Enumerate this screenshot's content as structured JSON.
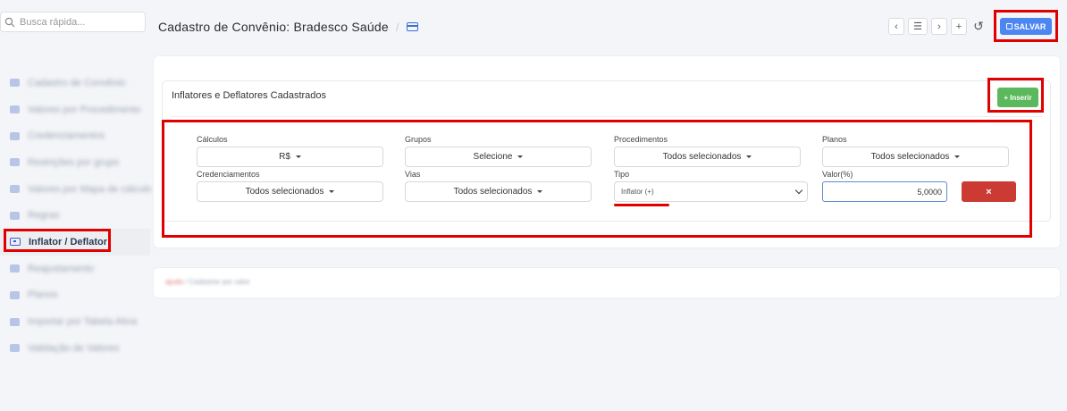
{
  "search": {
    "placeholder": "Busca rápida..."
  },
  "sidebar": {
    "items": [
      {
        "label": "Cadastro de Convênio",
        "active": false
      },
      {
        "label": "Valores por Procedimento",
        "active": false
      },
      {
        "label": "Credenciamentos",
        "active": false
      },
      {
        "label": "Restrições por grupo",
        "active": false
      },
      {
        "label": "Valores por Mapa de cálculo",
        "active": false
      },
      {
        "label": "Regras",
        "active": false
      },
      {
        "label": "Inflator / Deflator",
        "active": true
      },
      {
        "label": "Reajustamento",
        "active": false
      },
      {
        "label": "Planos",
        "active": false
      },
      {
        "label": "Importar por Tabela Ativa",
        "active": false
      },
      {
        "label": "Validação de Valores",
        "active": false
      }
    ]
  },
  "header": {
    "title": "Cadastro de Convênio: Bradesco Saúde",
    "separator": "/"
  },
  "toolbar": {
    "save_label": "SALVAR",
    "prev": "‹",
    "list": "☰",
    "next": "›",
    "add": "+",
    "history": "↺"
  },
  "panel": {
    "title": "Inflatores e Deflatores Cadastrados",
    "insert_label": "Inserir",
    "insert_plus": "+"
  },
  "form": {
    "calculos": {
      "label": "Cálculos",
      "value": "R$"
    },
    "grupos": {
      "label": "Grupos",
      "value": "Selecione"
    },
    "procedimentos": {
      "label": "Procedimentos",
      "value": "Todos selecionados"
    },
    "planos": {
      "label": "Planos",
      "value": "Todos selecionados"
    },
    "credenciamentos": {
      "label": "Credenciamentos",
      "value": "Todos selecionados"
    },
    "vias": {
      "label": "Vias",
      "value": "Todos selecionados"
    },
    "tipo": {
      "label": "Tipo",
      "value": "Inflator (+)"
    },
    "valor": {
      "label": "Valor(%)",
      "value": "5,0000"
    },
    "delete_label": "×"
  },
  "lower_panel": {
    "prefix": "ajuda",
    "text": " / Cadastrar por valor"
  },
  "colors": {
    "primary": "#4d86f0",
    "success": "#5cb85c",
    "danger": "#cc3b33",
    "highlight": "#e00000"
  }
}
